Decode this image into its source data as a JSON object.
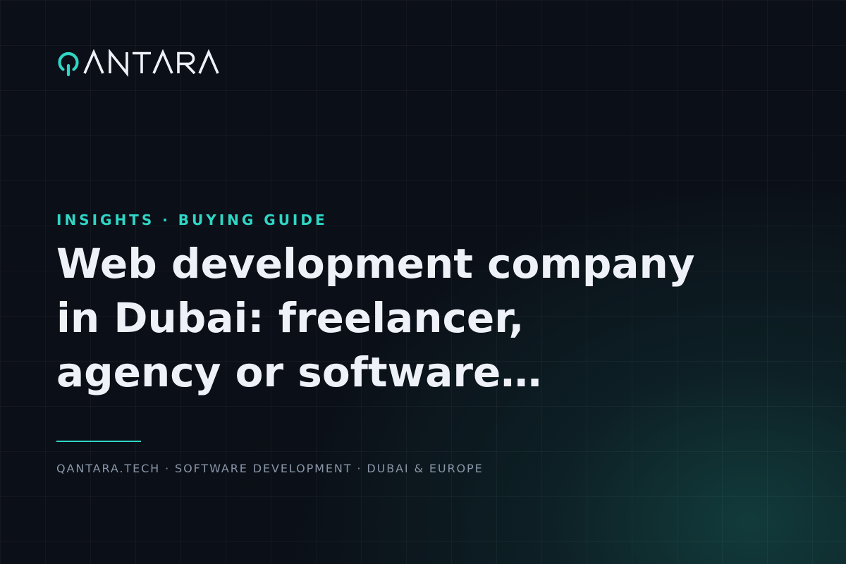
{
  "brand": {
    "wordmark": "QANTARA",
    "colors": {
      "accent": "#2fd6c5",
      "wordmark_text": "#eef2f8",
      "background": "#0b0f17"
    }
  },
  "article": {
    "eyebrow": "INSIGHTS · BUYING GUIDE",
    "title_lines": [
      "Web development company",
      "in Dubai: freelancer,",
      "agency or software…"
    ]
  },
  "footer": {
    "meta": "QANTARA.TECH · SOFTWARE DEVELOPMENT · DUBAI & EUROPE"
  }
}
